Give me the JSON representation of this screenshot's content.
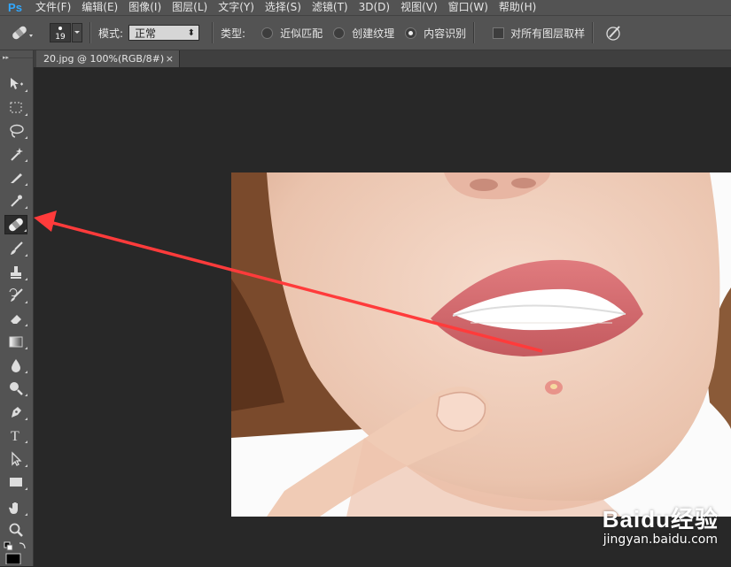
{
  "app": {
    "logo": "Ps"
  },
  "menu": [
    "文件(F)",
    "编辑(E)",
    "图像(I)",
    "图层(L)",
    "文字(Y)",
    "选择(S)",
    "滤镜(T)",
    "3D(D)",
    "视图(V)",
    "窗口(W)",
    "帮助(H)"
  ],
  "options": {
    "brush_size": "19",
    "mode_label": "模式:",
    "mode_value": "正常",
    "type_label": "类型:",
    "radio_proximity": "近似匹配",
    "radio_texture": "创建纹理",
    "radio_content_aware": "内容识别",
    "selected_type": "内容识别",
    "sample_all_layers": "对所有图层取样",
    "sample_all_layers_checked": false
  },
  "document": {
    "tab_title": "20.jpg @ 100%(RGB/8#)",
    "close_glyph": "×"
  },
  "tools": [
    "move-tool",
    "marquee-tool",
    "lasso-tool",
    "magic-wand-tool",
    "crop-tool",
    "eyedropper-tool",
    "spot-healing-brush-tool",
    "brush-tool",
    "clone-stamp-tool",
    "history-brush-tool",
    "eraser-tool",
    "gradient-tool",
    "blur-tool",
    "dodge-tool",
    "pen-tool",
    "type-tool",
    "path-selection-tool",
    "rectangle-tool",
    "hand-tool",
    "zoom-tool"
  ],
  "selected_tool": "spot-healing-brush-tool",
  "watermark": {
    "brand": "Baidu经验",
    "url": "jingyan.baidu.com"
  },
  "colors": {
    "arrow": "#ff3b3b",
    "ps_blue": "#31a8ff",
    "panel": "#535353",
    "canvas_bg": "#282828"
  }
}
